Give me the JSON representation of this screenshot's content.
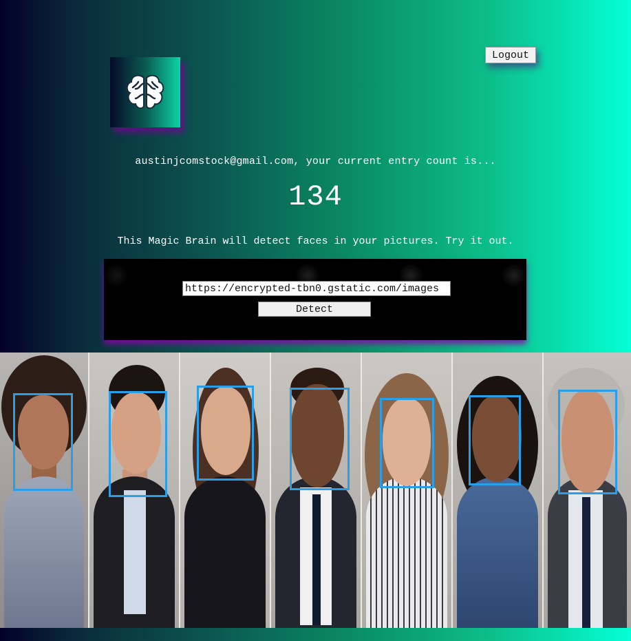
{
  "header": {
    "logout_label": "Logout",
    "logo_icon": "brain-icon"
  },
  "rank": {
    "welcome_text": "austinjcomstock@gmail.com, your current entry count is...",
    "count": "134"
  },
  "intro_text": "This Magic Brain will detect faces in your pictures. Try it out.",
  "form": {
    "url_value": "https://encrypted-tbn0.gstatic.com/images",
    "detect_label": "Detect"
  },
  "colors": {
    "accent_shadow": "#8c00aa",
    "bbox_color": "#2a9ee6",
    "gradient_start": "#04002a",
    "gradient_end": "#05ffd6"
  },
  "detection": {
    "faces_detected": 7
  }
}
